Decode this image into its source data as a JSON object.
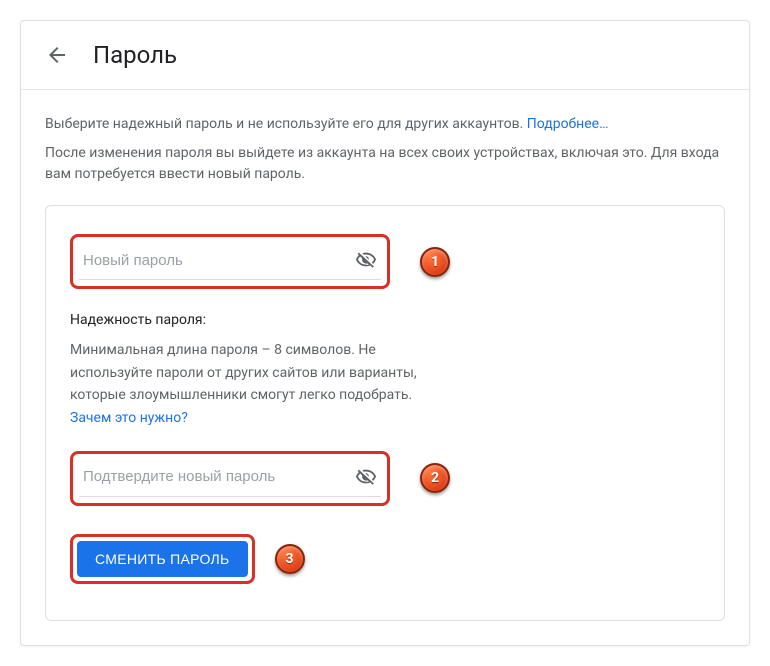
{
  "header": {
    "title": "Пароль"
  },
  "description": {
    "line1": "Выберите надежный пароль и не используйте его для других аккаунтов.",
    "learnMore": "Подробнее…",
    "line2": "После изменения пароля вы выйдете из аккаунта на всех своих устройствах, включая это. Для входа вам потребуется ввести новый пароль."
  },
  "form": {
    "newPassword": {
      "placeholder": "Новый пароль"
    },
    "strength": {
      "title": "Надежность пароля:",
      "text": "Минимальная длина пароля – 8 символов. Не используйте пароли от других сайтов или варианты, которые злоумышленники смогут легко подобрать.",
      "whyLink": "Зачем это нужно?"
    },
    "confirmPassword": {
      "placeholder": "Подтвердите новый пароль"
    },
    "submitLabel": "СМЕНИТЬ ПАРОЛЬ"
  },
  "callouts": {
    "one": "1",
    "two": "2",
    "three": "3"
  }
}
